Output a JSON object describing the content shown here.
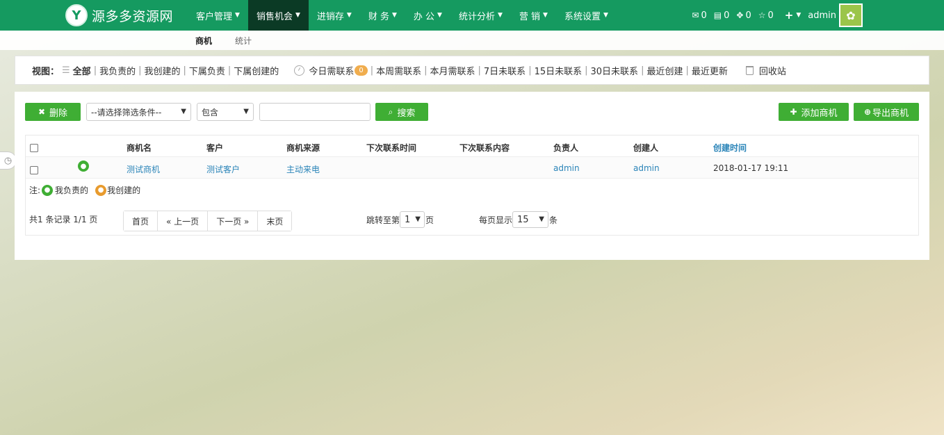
{
  "brand": {
    "logo_char": "Y",
    "name": "源多多资源网"
  },
  "nav": {
    "items": [
      {
        "label": "客户管理",
        "active": false
      },
      {
        "label": "销售机会",
        "active": true
      },
      {
        "label": "进销存",
        "active": false
      },
      {
        "label": "财 务",
        "active": false
      },
      {
        "label": "办 公",
        "active": false
      },
      {
        "label": "统计分析",
        "active": false
      },
      {
        "label": "营 销",
        "active": false
      },
      {
        "label": "系统设置",
        "active": false
      }
    ],
    "right": {
      "mail_count": "0",
      "msg_count": "0",
      "task_count": "0",
      "star_count": "0",
      "plus_label": "+",
      "user_name": "admin"
    }
  },
  "subtabs": [
    {
      "label": "商机",
      "active": true
    },
    {
      "label": "统计",
      "active": false
    }
  ],
  "viewbar": {
    "label": "视图：",
    "links": [
      "全部",
      "我负责的",
      "我创建的",
      "下属负责",
      "下属创建的"
    ],
    "today_label": "今日需联系",
    "today_badge": "0",
    "time_links": [
      "本周需联系",
      "本月需联系",
      "7日未联系",
      "15日未联系",
      "30日未联系",
      "最近创建",
      "最近更新"
    ],
    "recycle_label": "回收站"
  },
  "toolbar": {
    "delete_label": "删除",
    "filter_placeholder": "--请选择筛选条件--",
    "operator_value": "包含",
    "search_label": "搜索",
    "add_label": "添加商机",
    "export_label": "导出商机"
  },
  "table": {
    "columns": [
      "商机名",
      "客户",
      "商机来源",
      "下次联系时间",
      "下次联系内容",
      "负责人",
      "创建人",
      "创建时间"
    ],
    "rows": [
      {
        "name": "测试商机",
        "customer": "测试客户",
        "source": "主动来电",
        "next_time": "",
        "next_content": "",
        "owner": "admin",
        "creator": "admin",
        "created": "2018-01-17 19:11"
      }
    ]
  },
  "note": {
    "prefix": "注:",
    "mine": "我负责的",
    "created": "我创建的"
  },
  "pager": {
    "summary": "共1 条记录 1/1 页",
    "first": "首页",
    "prev": "« 上一页",
    "next": "下一页 »",
    "last": "末页",
    "jump_label": "跳转至第",
    "jump_value": "1",
    "jump_suffix": "页",
    "per_page_label": "每页显示",
    "per_page_value": "15",
    "per_page_suffix": "条"
  },
  "colors": {
    "navbar": "#159a60",
    "nav_active": "#0b3a25",
    "button_green": "#3fae34",
    "link_blue": "#2a84b8",
    "badge_orange": "#f0ad4e"
  }
}
